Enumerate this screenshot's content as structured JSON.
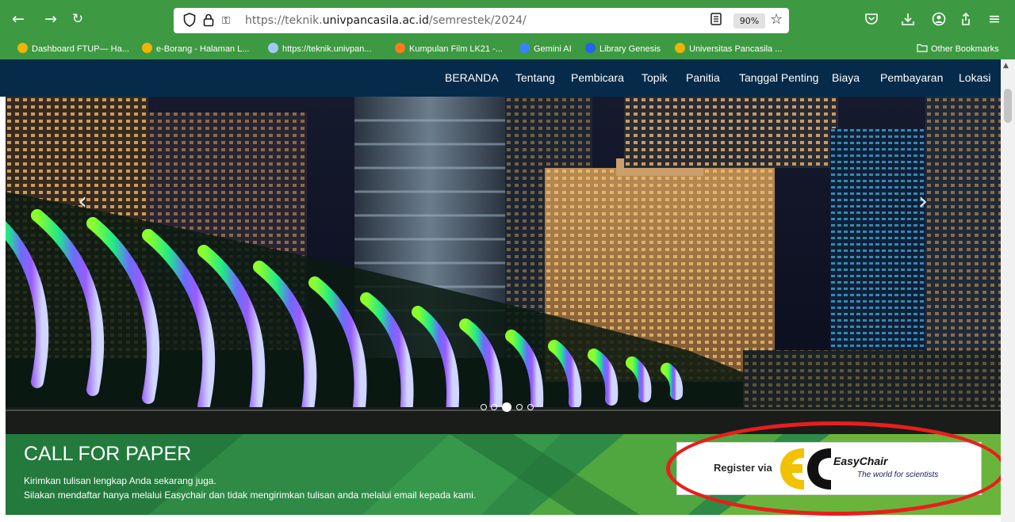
{
  "browser": {
    "url_prefix": "https://teknik.",
    "url_domain": "univpancasila.ac.id",
    "url_path": "/semrestek/2024/",
    "zoom": "90%",
    "other_bookmarks": "Other Bookmarks",
    "bookmarks": [
      {
        "label": "Dashboard FTUP— Ha...",
        "icon_color": "#f0b400"
      },
      {
        "label": "e-Borang - Halaman L...",
        "icon_color": "#f0b400"
      },
      {
        "label": "https://teknik.univpan...",
        "icon_color": "#9ec9ff"
      },
      {
        "label": "Kumpulan Film LK21 -...",
        "icon_color": "#ff7a1a"
      },
      {
        "label": "Gemini AI",
        "icon_color": "#3b82f6"
      },
      {
        "label": "Library Genesis",
        "icon_color": "#2563eb"
      },
      {
        "label": "Universitas Pancasila ...",
        "icon_color": "#f0b400"
      }
    ]
  },
  "nav": {
    "items": [
      "BERANDA",
      "Tentang",
      "Pembicara",
      "Topik",
      "Panitia",
      "Tanggal Penting",
      "Biaya",
      "Pembayaran",
      "Lokasi"
    ]
  },
  "carousel": {
    "slide_count": 5,
    "active_index": 2
  },
  "cfp": {
    "title": "CALL FOR PAPER",
    "line1": "Kirimkan tulisan lengkap Anda sekarang juga.",
    "line2": "Silakan mendaftar hanya melalui Easychair dan tidak mengirimkan tulisan anda melalui email kepada kami."
  },
  "easychair": {
    "register_label": "Register via",
    "brand": "EasyChair",
    "tagline": "The world for scientists"
  },
  "colors": {
    "chrome_green": "#3d9a43",
    "navbar": "#062b4a",
    "cfp_green": "#2e8a45",
    "annotation_red": "#ea1d1d"
  }
}
